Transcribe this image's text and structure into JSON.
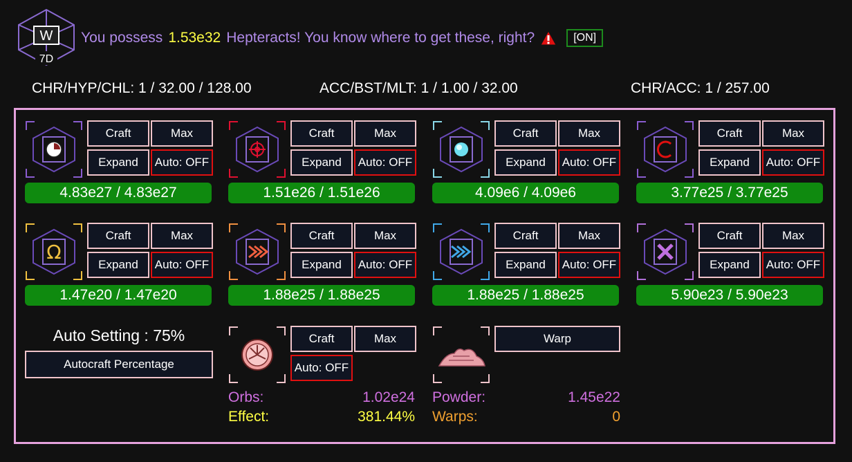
{
  "header": {
    "logo_label": "7D",
    "text_prefix": "You possess",
    "amount": "1.53e32",
    "text_suffix": "Hepteracts! You know where to get these, right?",
    "toggle_label": "[ON]"
  },
  "stats": {
    "chr_hyp_chl": "CHR/HYP/CHL: 1 / 32.00 / 128.00",
    "acc_bst_mlt": "ACC/BST/MLT: 1 / 1.00 / 32.00",
    "chr_acc": "CHR/ACC: 1 / 257.00"
  },
  "labels": {
    "craft": "Craft",
    "max": "Max",
    "expand": "Expand",
    "auto_off": "Auto: OFF",
    "warp": "Warp"
  },
  "cubes": [
    {
      "name": "chronos",
      "value": "4.83e27 / 4.83e27",
      "accent": "#8a5cd0",
      "color": "#ffffff"
    },
    {
      "name": "hyperrealism",
      "value": "1.51e26 / 1.51e26",
      "accent": "#e01030",
      "color": "#e01030"
    },
    {
      "name": "quark",
      "value": "4.09e6 / 4.09e6",
      "accent": "#8ad8e8",
      "color": "#6ee0f0"
    },
    {
      "name": "challenge",
      "value": "3.77e25 / 3.77e25",
      "accent": "#8a5cd0",
      "color": "#e01010"
    },
    {
      "name": "abyss",
      "value": "1.47e20 / 1.47e20",
      "accent": "#f0c040",
      "color": "#f0c040"
    },
    {
      "name": "accelerator",
      "value": "1.88e25 / 1.88e25",
      "accent": "#f09040",
      "color": "#f06040"
    },
    {
      "name": "acceleratorboost",
      "value": "1.88e25 / 1.88e25",
      "accent": "#40a8e8",
      "color": "#40a8e8"
    },
    {
      "name": "multiplier",
      "value": "5.90e23 / 5.90e23",
      "accent": "#b070d8",
      "color": "#c070e0"
    }
  ],
  "auto_setting": {
    "label": "Auto Setting : 75%",
    "button": "Autocraft Percentage"
  },
  "orbs": {
    "orbs_label": "Orbs:",
    "orbs_value": "1.02e24",
    "effect_label": "Effect:",
    "effect_value": "381.44%"
  },
  "powder": {
    "powder_label": "Powder:",
    "powder_value": "1.45e22",
    "warps_label": "Warps:",
    "warps_value": "0"
  },
  "colors": {
    "panel_border": "#e4a1dc",
    "button_border": "#f0c4cb",
    "auto_off_border": "#e01010",
    "bar_green": "#0f8a0f",
    "header_text": "#b08ae8",
    "amount_yellow": "#ffff44"
  }
}
